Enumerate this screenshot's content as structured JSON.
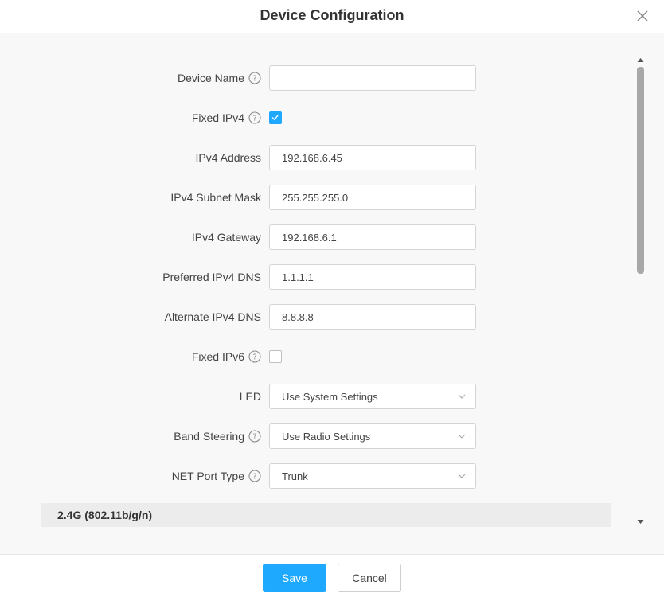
{
  "dialog": {
    "title": "Device Configuration"
  },
  "form": {
    "device_name": {
      "label": "Device Name",
      "value": ""
    },
    "fixed_ipv4": {
      "label": "Fixed IPv4",
      "checked": true
    },
    "ipv4_address": {
      "label": "IPv4 Address",
      "value": "192.168.6.45"
    },
    "ipv4_subnet_mask": {
      "label": "IPv4 Subnet Mask",
      "value": "255.255.255.0"
    },
    "ipv4_gateway": {
      "label": "IPv4 Gateway",
      "value": "192.168.6.1"
    },
    "preferred_ipv4_dns": {
      "label": "Preferred IPv4 DNS",
      "value": "1.1.1.1"
    },
    "alternate_ipv4_dns": {
      "label": "Alternate IPv4 DNS",
      "value": "8.8.8.8"
    },
    "fixed_ipv6": {
      "label": "Fixed IPv6",
      "checked": false
    },
    "led": {
      "label": "LED",
      "value": "Use System Settings"
    },
    "band_steering": {
      "label": "Band Steering",
      "value": "Use Radio Settings"
    },
    "net_port_type": {
      "label": "NET Port Type",
      "value": "Trunk"
    }
  },
  "section": {
    "radio_24g": "2.4G (802.11b/g/n)"
  },
  "footer": {
    "save_label": "Save",
    "cancel_label": "Cancel"
  },
  "colors": {
    "accent": "#1ea9ff",
    "body_bg": "#f8f8f9",
    "section_bg": "#ececed"
  },
  "icons": {
    "help": "help-circle-icon",
    "close": "close-icon",
    "chevron": "chevron-down-icon",
    "check": "checkmark-icon"
  }
}
